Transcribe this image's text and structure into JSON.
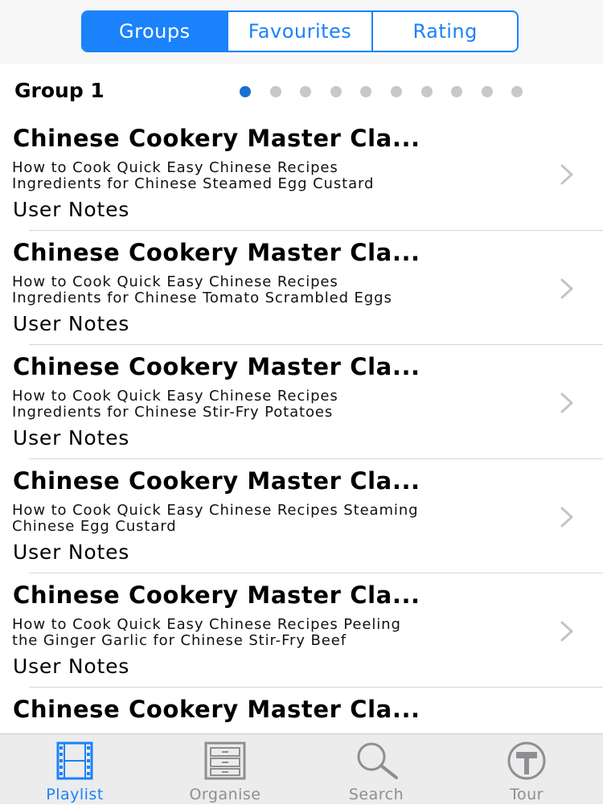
{
  "segmented": {
    "items": [
      "Groups",
      "Favourites",
      "Rating"
    ],
    "selected": "Groups"
  },
  "group": {
    "title": "Group 1",
    "page_count": 10,
    "current_page": 1
  },
  "rows": [
    {
      "title": "Chinese Cookery Master Cla...",
      "subtitle": "How to Cook Quick  Easy Chinese Recipes\nIngredients for Chinese Steamed Egg Custard",
      "notes": "User Notes"
    },
    {
      "title": "Chinese Cookery Master Cla...",
      "subtitle": "How to Cook Quick  Easy Chinese Recipes\nIngredients for Chinese Tomato Scrambled Eggs",
      "notes": "User Notes"
    },
    {
      "title": "Chinese Cookery Master Cla...",
      "subtitle": "How to Cook Quick  Easy Chinese Recipes\nIngredients for Chinese Stir-Fry Potatoes",
      "notes": "User Notes"
    },
    {
      "title": "Chinese Cookery Master Cla...",
      "subtitle": "How to Cook Quick  Easy Chinese Recipes  Steaming\nChinese Egg Custard",
      "notes": "User Notes"
    },
    {
      "title": "Chinese Cookery Master Cla...",
      "subtitle": "How to Cook Quick  Easy Chinese Recipes  Peeling\nthe Ginger  Garlic for Chinese Stir-Fry Beef",
      "notes": "User Notes"
    },
    {
      "title": "Chinese Cookery Master Cla...",
      "subtitle": "",
      "notes": ""
    }
  ],
  "tabbar": {
    "items": [
      {
        "label": "Playlist",
        "icon": "film-icon",
        "active": true
      },
      {
        "label": "Organise",
        "icon": "cabinet-icon",
        "active": false
      },
      {
        "label": "Search",
        "icon": "magnifier-icon",
        "active": false
      },
      {
        "label": "Tour",
        "icon": "hammer-icon",
        "active": false
      }
    ]
  },
  "colors": {
    "accent": "#1a82fb",
    "page_dot_active": "#1a6fd3",
    "page_dot_inactive": "#c7c7cc",
    "tab_inactive": "#8e8e93"
  }
}
